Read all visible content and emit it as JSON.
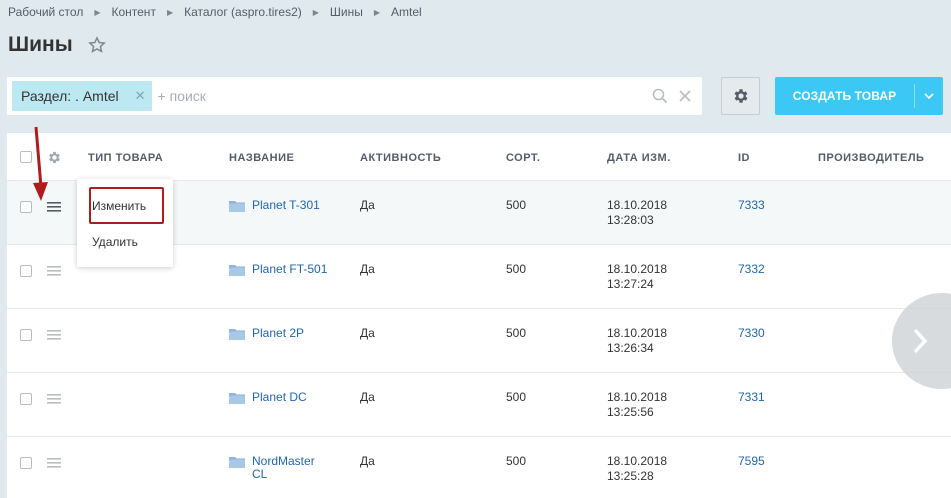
{
  "breadcrumb": [
    "Рабочий стол",
    "Контент",
    "Каталог (aspro.tires2)",
    "Шины",
    "Amtel"
  ],
  "page_title": "Шины",
  "filter": {
    "tag_label": "Раздел: . Amtel",
    "search_placeholder": "+ поиск"
  },
  "toolbar": {
    "create_label": "СОЗДАТЬ ТОВАР"
  },
  "table": {
    "columns": [
      "ТИП ТОВАРА",
      "НАЗВАНИЕ",
      "АКТИВНОСТЬ",
      "СОРТ.",
      "ДАТА ИЗМ.",
      "ID",
      "ПРОИЗВОДИТЕЛЬ"
    ],
    "rows": [
      {
        "name": "Planet T-301",
        "active": "Да",
        "sort": "500",
        "date": "18.10.2018",
        "time": "13:28:03",
        "id": "7333"
      },
      {
        "name": "Planet FT-501",
        "active": "Да",
        "sort": "500",
        "date": "18.10.2018",
        "time": "13:27:24",
        "id": "7332"
      },
      {
        "name": "Planet 2P",
        "active": "Да",
        "sort": "500",
        "date": "18.10.2018",
        "time": "13:26:34",
        "id": "7330"
      },
      {
        "name": "Planet DC",
        "active": "Да",
        "sort": "500",
        "date": "18.10.2018",
        "time": "13:25:56",
        "id": "7331"
      },
      {
        "name": "NordMaster CL",
        "active": "Да",
        "sort": "500",
        "date": "18.10.2018",
        "time": "13:25:28",
        "id": "7595"
      }
    ]
  },
  "context_menu": {
    "items": [
      "Изменить",
      "Удалить"
    ]
  },
  "colors": {
    "accent": "#3bc8f5",
    "link": "#2067b0",
    "highlight": "#b01c1c",
    "filter_tag": "#bce8f1"
  }
}
